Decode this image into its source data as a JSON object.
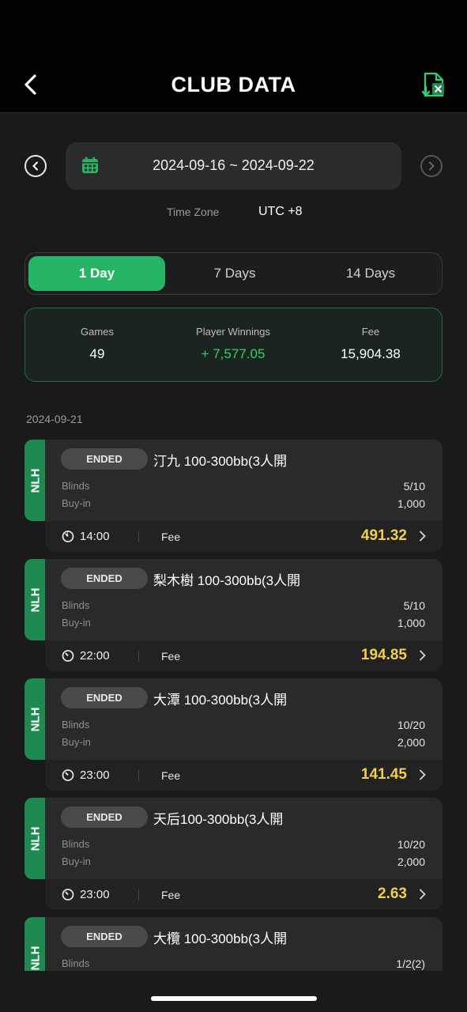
{
  "header": {
    "title": "CLUB DATA"
  },
  "date_range": "2024-09-16 ~ 2024-09-22",
  "timezone": {
    "label": "Time Zone",
    "value": "UTC +8"
  },
  "tabs": [
    "1 Day",
    "7 Days",
    "14 Days"
  ],
  "active_tab": "1 Day",
  "summary": {
    "games_label": "Games",
    "games_value": "49",
    "winnings_label": "Player Winnings",
    "winnings_value": "+ 7,577.05",
    "fee_label": "Fee",
    "fee_value": "15,904.38"
  },
  "group_date": "2024-09-21",
  "labels": {
    "blinds": "Blinds",
    "buyin": "Buy-in",
    "fee": "Fee"
  },
  "games": [
    {
      "type": "NLH",
      "status": "ENDED",
      "name": "汀九 100-300bb(3人開",
      "blinds": "5/10",
      "buyin": "1,000",
      "time": "14:00",
      "fee": "491.32"
    },
    {
      "type": "NLH",
      "status": "ENDED",
      "name": "梨木樹 100-300bb(3人開",
      "blinds": "5/10",
      "buyin": "1,000",
      "time": "22:00",
      "fee": "194.85"
    },
    {
      "type": "NLH",
      "status": "ENDED",
      "name": "大潭 100-300bb(3人開",
      "blinds": "10/20",
      "buyin": "2,000",
      "time": "23:00",
      "fee": "141.45"
    },
    {
      "type": "NLH",
      "status": "ENDED",
      "name": "天后100-300bb(3人開",
      "blinds": "10/20",
      "buyin": "2,000",
      "time": "23:00",
      "fee": "2.63"
    },
    {
      "type": "NLH",
      "status": "ENDED",
      "name": "大欖 100-300bb(3人開",
      "blinds": "1/2(2)"
    }
  ],
  "colors": {
    "accent": "#26b565",
    "fee": "#f2cf4a",
    "winnings": "#2fcf74",
    "type_tab": "#1e8a4f"
  }
}
